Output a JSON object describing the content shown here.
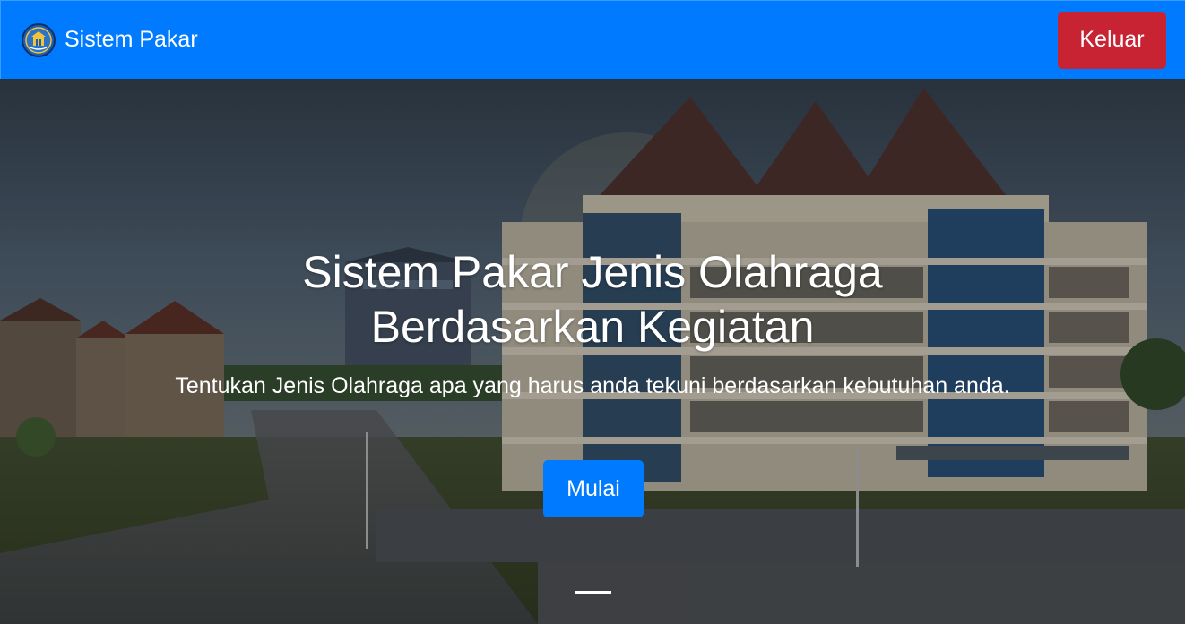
{
  "navbar": {
    "brand": "Sistem Pakar",
    "logo_icon": "university-crest-icon",
    "logout_label": "Keluar",
    "background_color": "#007bff",
    "logout_color": "#c82333"
  },
  "hero": {
    "title": "Sistem Pakar Jenis Olahraga Berdasarkan Kegiatan",
    "subtitle": "Tentukan Jenis Olahraga apa yang harus anda tekuni berdasarkan kebutuhan anda.",
    "start_label": "Mulai",
    "slide_count": 1,
    "active_slide": 1
  }
}
